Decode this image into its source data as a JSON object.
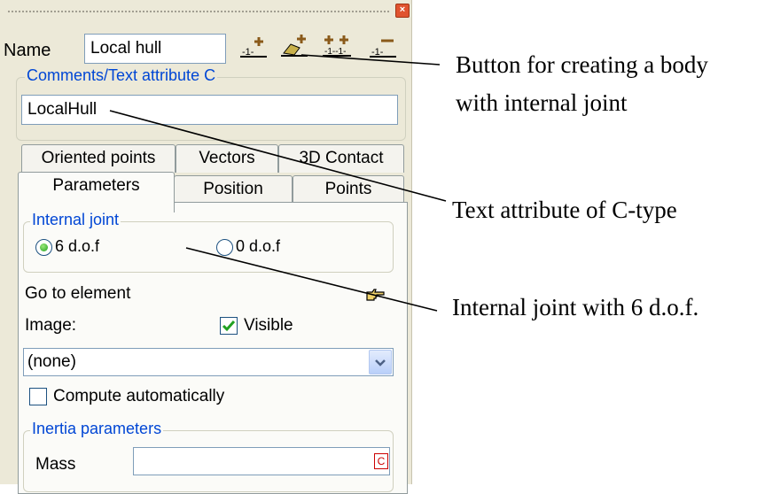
{
  "panel": {
    "name_label": "Name",
    "name_value": "Local hull",
    "comments_legend": "Comments/Text attribute C",
    "comments_value": "LocalHull",
    "close_glyph": "×",
    "toolbar_icons": [
      "create-body-icon",
      "create-body-internal-joint-icon",
      "create-pair-icon",
      "remove-body-icon"
    ]
  },
  "tabs": {
    "row1": [
      "Oriented points",
      "Vectors",
      "3D Contact"
    ],
    "row2": [
      "Parameters",
      "Position",
      "Points"
    ],
    "active": "Parameters"
  },
  "internal_joint": {
    "legend": "Internal joint",
    "option1": "6 d.o.f",
    "option2": "0 d.o.f",
    "selected": "6 d.o.f"
  },
  "goto": {
    "label": "Go to element",
    "icon": "pointing-hand-icon"
  },
  "image": {
    "label": "Image:",
    "visible_label": "Visible",
    "visible_checked": true,
    "dropdown_value": "(none)"
  },
  "compute": {
    "label": "Compute automatically",
    "checked": false
  },
  "inertia": {
    "legend": "Inertia parameters",
    "mass_label": "Mass",
    "mass_value": "",
    "mass_badge": "C"
  },
  "annotations": {
    "a1_line1": "Button for creating a body",
    "a1_line2": "with internal joint",
    "a2": "Text attribute of C-type",
    "a3": "Internal joint with 6 d.o.f."
  },
  "colors": {
    "accent_blue": "#0046d5",
    "radio_green": "#21a121",
    "check_green": "#21a121",
    "panel_bg": "#ece9d8"
  }
}
